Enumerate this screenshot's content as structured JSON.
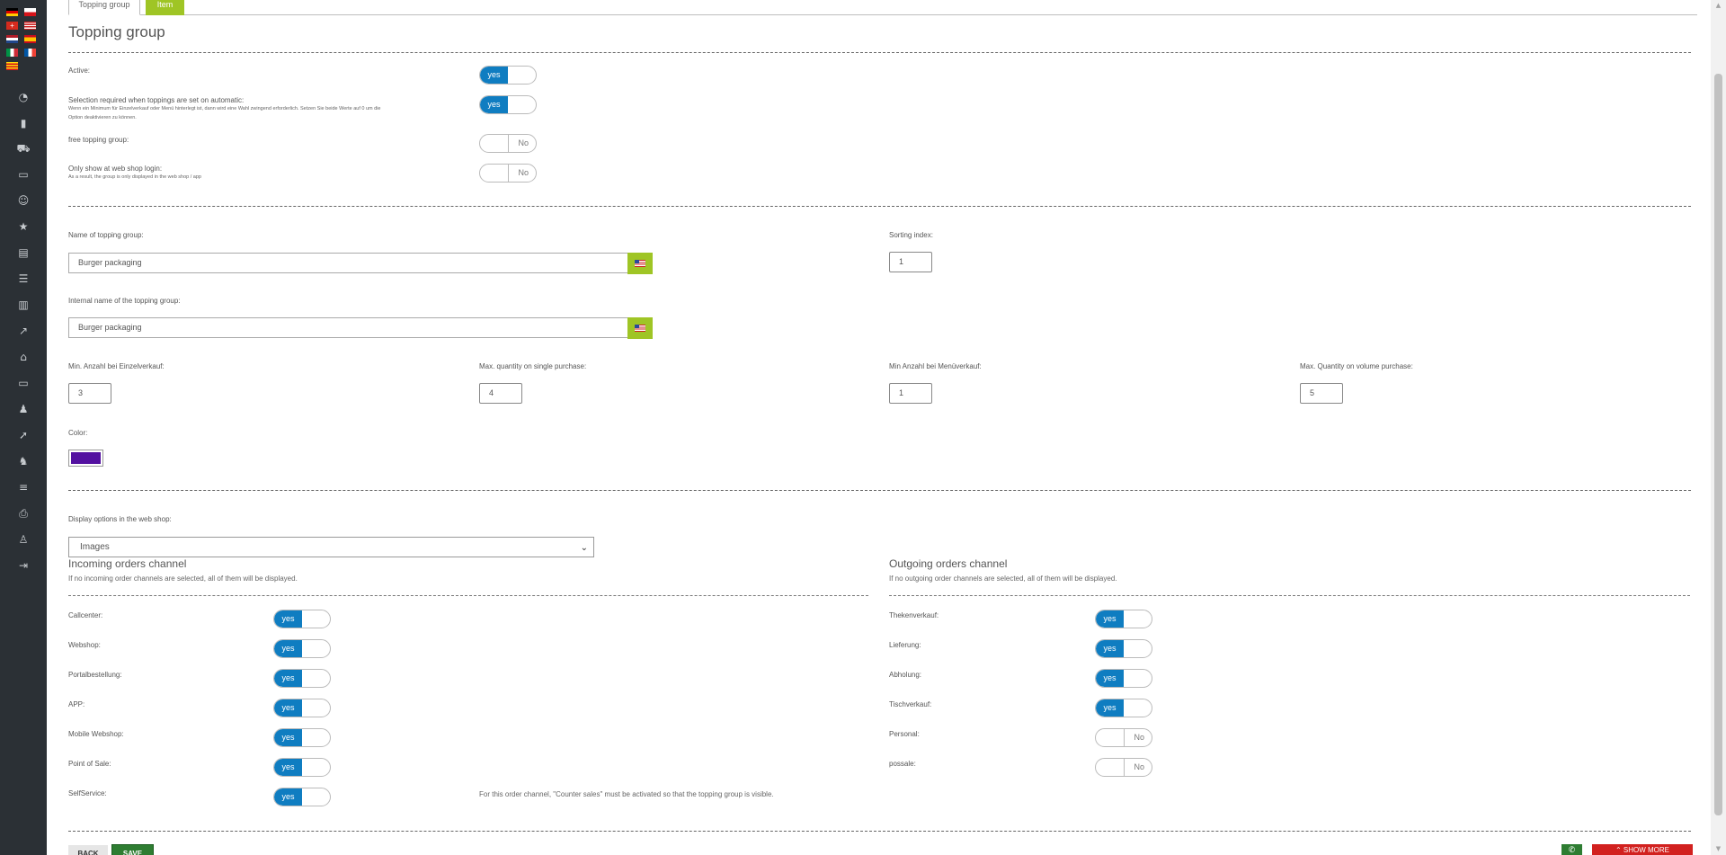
{
  "tabs": {
    "topping_group": "Topping group",
    "item": "Item"
  },
  "page_title": "Topping group",
  "general": {
    "active_label": "Active:",
    "active_value": "yes",
    "selection_label": "Selection required when toppings are set on automatic:",
    "selection_sub1": "Wenn ein Minimum für Einzelverkauf oder Menü hinterlegt ist, dann wird eine Wahl zwingend erforderlich. Setzen Sie beide Werte auf 0 um die",
    "selection_sub2": "Option deaktivieren zu können.",
    "selection_value": "yes",
    "free_label": "free topping group:",
    "free_value": "No",
    "webshop_login_label": "Only show at web shop login:",
    "webshop_login_sub": "As a result, the group is only displayed in the web shop / app",
    "webshop_login_value": "No"
  },
  "fields": {
    "name_label": "Name of topping group:",
    "name_value": "Burger packaging",
    "sorting_label": "Sorting index:",
    "sorting_value": "1",
    "internal_label": "Internal name of the topping group:",
    "internal_value": "Burger packaging",
    "min_single_label": "Min. Anzahl bei Einzelverkauf:",
    "min_single_value": "3",
    "max_single_label": "Max. quantity on single purchase:",
    "max_single_value": "4",
    "min_menu_label": "Min Anzahl bei Menüverkauf:",
    "min_menu_value": "1",
    "max_volume_label": "Max. Quantity on volume purchase:",
    "max_volume_value": "5",
    "color_label": "Color:",
    "color_value": "#5311a0"
  },
  "display": {
    "label": "Display options in the web shop:",
    "selected": "Images"
  },
  "incoming": {
    "title": "Incoming orders channel",
    "hint": "If no incoming order channels are selected, all of them will be displayed.",
    "items": [
      {
        "label": "Callcenter:",
        "value": "yes"
      },
      {
        "label": "Webshop:",
        "value": "yes"
      },
      {
        "label": "Portalbestellung:",
        "value": "yes"
      },
      {
        "label": "APP:",
        "value": "yes"
      },
      {
        "label": "Mobile Webshop:",
        "value": "yes"
      },
      {
        "label": "Point of Sale:",
        "value": "yes"
      },
      {
        "label": "SelfService:",
        "value": "yes"
      }
    ],
    "selfservice_note": "For this order channel, \"Counter sales\" must be activated so that the topping group is visible."
  },
  "outgoing": {
    "title": "Outgoing orders channel",
    "hint": "If no outgoing order channels are selected, all of them will be displayed.",
    "items": [
      {
        "label": "Thekenverkauf:",
        "value": "yes"
      },
      {
        "label": "Lieferung:",
        "value": "yes"
      },
      {
        "label": "Abholung:",
        "value": "yes"
      },
      {
        "label": "Tischverkauf:",
        "value": "yes"
      },
      {
        "label": "Personal:",
        "value": "No"
      },
      {
        "label": "possale:",
        "value": "No"
      }
    ]
  },
  "buttons": {
    "back": "BACK",
    "save": "SAVE",
    "show_more": "SHOW MORE"
  },
  "icons": {
    "sidebar": [
      "dashboard-icon",
      "chart-icon",
      "cart-icon",
      "monitor-icon",
      "user-plus-icon",
      "star-icon",
      "archive-icon",
      "list-icon",
      "book-icon",
      "trend-icon",
      "home-icon",
      "desktop-icon",
      "user-icon",
      "rocket-icon",
      "users-icon",
      "database-icon",
      "printer-icon",
      "account-icon",
      "logout-icon"
    ]
  },
  "colors": {
    "accent_blue": "#0f7dc1",
    "accent_green": "#9fc525",
    "sidebar": "#2b3035",
    "danger": "#d2211f"
  }
}
